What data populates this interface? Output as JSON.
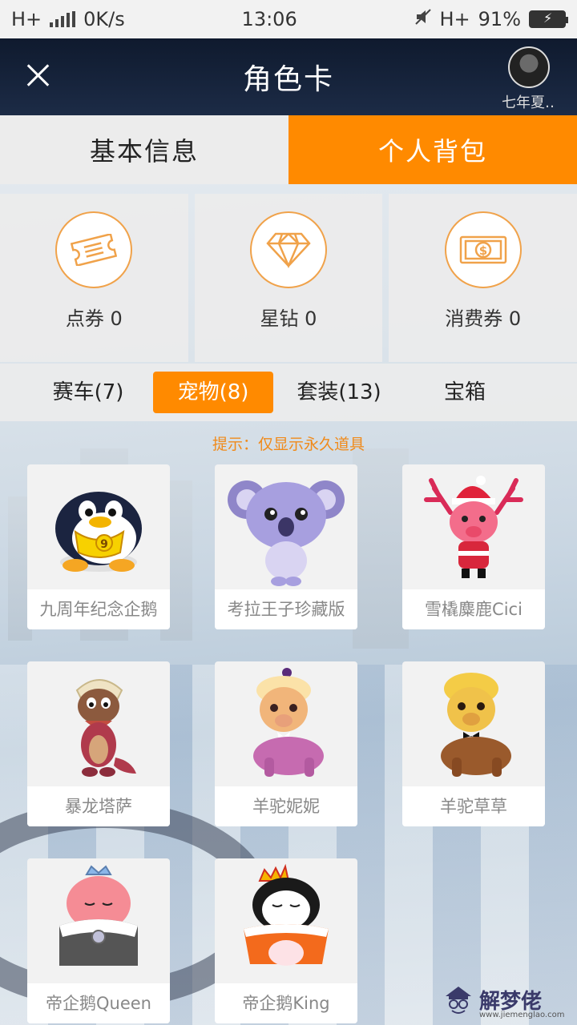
{
  "status_bar": {
    "network_left": "H+",
    "speed": "0K/s",
    "time": "13:06",
    "network_right": "H+",
    "battery": "91%"
  },
  "header": {
    "title": "角色卡",
    "username": "七年夏‥"
  },
  "tabs": [
    {
      "label": "基本信息",
      "active": false
    },
    {
      "label": "个人背包",
      "active": true
    }
  ],
  "currencies": [
    {
      "icon": "ticket-icon",
      "label": "点券 0"
    },
    {
      "icon": "diamond-icon",
      "label": "星钻 0"
    },
    {
      "icon": "dollar-bill-icon",
      "label": "消费券 0"
    }
  ],
  "categories": [
    {
      "label": "赛车(7)",
      "active": false
    },
    {
      "label": "宠物(8)",
      "active": true
    },
    {
      "label": "套装(13)",
      "active": false
    },
    {
      "label": "宝箱",
      "active": false
    }
  ],
  "hint": "提示：仅显示永久道具",
  "pets": [
    {
      "name": "九周年纪念企鹅",
      "icon": "penguin-icon"
    },
    {
      "name": "考拉王子珍藏版",
      "icon": "koala-icon"
    },
    {
      "name": "雪橇麋鹿Cici",
      "icon": "reindeer-icon"
    },
    {
      "name": "暴龙塔萨",
      "icon": "dinosaur-icon"
    },
    {
      "name": "羊驼妮妮",
      "icon": "alpaca-pink-icon"
    },
    {
      "name": "羊驼草草",
      "icon": "alpaca-brown-icon"
    },
    {
      "name": "帝企鹅Queen",
      "icon": "penguin-queen-icon"
    },
    {
      "name": "帝企鹅King",
      "icon": "penguin-king-icon"
    }
  ],
  "watermark": {
    "text": "解梦佬",
    "url": "www.jiemenglao.com"
  },
  "colors": {
    "accent": "#ff8a00",
    "hint": "#f08a1a",
    "header_bg": "#142238"
  }
}
